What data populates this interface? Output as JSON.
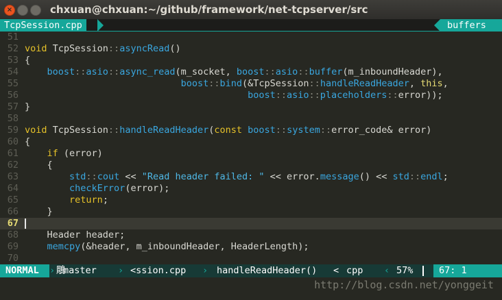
{
  "window": {
    "title": "chxuan@chxuan:~/github/framework/net-tcpserver/src",
    "close_glyph": "×"
  },
  "tabline": {
    "active_tab": "TcpSession.cpp",
    "right_label": "buffers"
  },
  "editor": {
    "lines": [
      {
        "num": "51",
        "text": ""
      },
      {
        "num": "52",
        "text": "void TcpSession::asyncRead()"
      },
      {
        "num": "53",
        "text": "{"
      },
      {
        "num": "54",
        "text": "    boost::asio::async_read(m_socket, boost::asio::buffer(m_inboundHeader),"
      },
      {
        "num": "55",
        "text": "                            boost::bind(&TcpSession::handleReadHeader, this,"
      },
      {
        "num": "56",
        "text": "                                        boost::asio::placeholders::error));"
      },
      {
        "num": "57",
        "text": "}"
      },
      {
        "num": "58",
        "text": ""
      },
      {
        "num": "59",
        "text": "void TcpSession::handleReadHeader(const boost::system::error_code& error)"
      },
      {
        "num": "60",
        "text": "{"
      },
      {
        "num": "61",
        "text": "    if (error)"
      },
      {
        "num": "62",
        "text": "    {"
      },
      {
        "num": "63",
        "text": "        std::cout << \"Read header failed: \" << error.message() << std::endl;"
      },
      {
        "num": "64",
        "text": "        checkError(error);"
      },
      {
        "num": "65",
        "text": "        return;"
      },
      {
        "num": "66",
        "text": "    }"
      },
      {
        "num": "67",
        "text": ""
      },
      {
        "num": "68",
        "text": "    Header header;"
      },
      {
        "num": "69",
        "text": "    memcpy(&header, m_inboundHeader, HeaderLength);"
      },
      {
        "num": "70",
        "text": ""
      }
    ],
    "current_line": "67"
  },
  "statusline": {
    "mode": "NORMAL",
    "branch_icon": "鵰",
    "branch": "master",
    "file": "<ssion.cpp",
    "function": "handleReadHeader()",
    "func_sep": "<",
    "filetype": "cpp",
    "percent": "57%",
    "position": "67:  1"
  },
  "watermark": "http://blog.csdn.net/yonggeit",
  "colors": {
    "background": "#272822",
    "accent": "#16a79a",
    "keyword": "#e6c229",
    "function": "#3aa7e0"
  }
}
